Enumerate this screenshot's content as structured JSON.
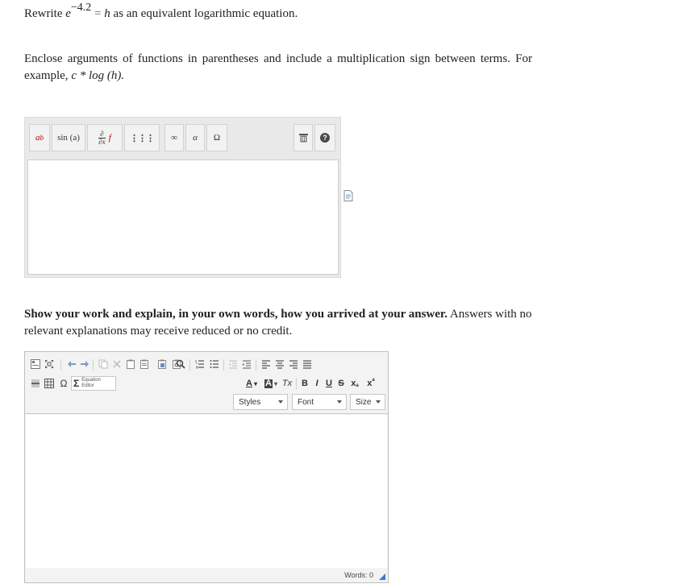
{
  "question": {
    "rewrite_word": "Rewrite",
    "base": "e",
    "exponent": "−4.2",
    "equals": "=",
    "variable": "h",
    "rest": "as an equivalent logarithmic equation.",
    "instructions_prefix": "Enclose arguments of functions in parentheses and include a multiplication sign between terms. For example,",
    "example_math": "c * log (h).",
    "work_bold": "Show your work and explain, in your own words, how you arrived at your answer.",
    "work_rest": "Answers with no relevant explanations may receive reduced or no credit."
  },
  "math_toolbar": {
    "power_label": "a",
    "power_sup": "b",
    "sin_label": "sin (a)",
    "deriv_top": "∂",
    "deriv_bottom": "∂x",
    "deriv_f": "f",
    "matrix_label": "⋮⋮⋮",
    "infinity_label": "∞",
    "alpha_label": "α",
    "omega_label": "Ω",
    "trash_label": "🗑",
    "help_label": "?"
  },
  "rte_toolbar": {
    "equation_editor_label": "Equation Editor",
    "omega": "Ω",
    "sigma": "Σ",
    "font_color": "A",
    "bg_color": "A",
    "clear_format": "Tx",
    "bold": "B",
    "italic": "I",
    "underline": "U",
    "strike": "S",
    "subscript": "x",
    "superscript": "x",
    "styles_label": "Styles",
    "font_label": "Font",
    "size_label": "Size"
  },
  "rte_status": {
    "words": "Words: 0"
  },
  "colors": {
    "accent": "#3a7bd5",
    "help_bg": "#4a4a4a"
  }
}
